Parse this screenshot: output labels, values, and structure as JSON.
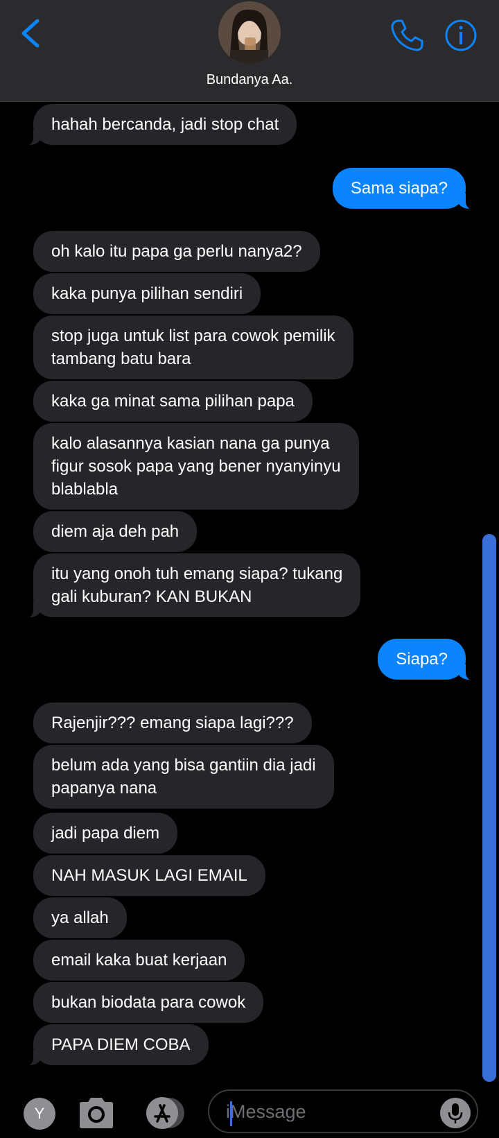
{
  "header": {
    "contact_name": "Bundanya Aa."
  },
  "messages": [
    {
      "dir": "in",
      "text": "hahah bercanda, jadi stop chat",
      "tail": true
    },
    {
      "dir": "out",
      "text": "Sama siapa?",
      "tail": true
    },
    {
      "dir": "in",
      "text": "oh kalo itu papa ga perlu nanya2?",
      "tail": false
    },
    {
      "dir": "in",
      "text": "kaka punya pilihan sendiri",
      "tail": false
    },
    {
      "dir": "in",
      "text": "stop juga untuk list para cowok pemilik\ntambang batu bara",
      "tail": false
    },
    {
      "dir": "in",
      "text": "kaka ga minat sama pilihan papa",
      "tail": false
    },
    {
      "dir": "in",
      "text": "kalo alasannya kasian nana ga punya\nfigur sosok papa yang bener nyanyinyu\nblablabla",
      "tail": false
    },
    {
      "dir": "in",
      "text": "diem aja deh pah",
      "tail": false
    },
    {
      "dir": "in",
      "text": "itu yang onoh tuh emang siapa? tukang\ngali kuburan? KAN BUKAN",
      "tail": true
    },
    {
      "dir": "out",
      "text": "Siapa?",
      "tail": true
    },
    {
      "dir": "in",
      "text": "Rajenjir??? emang siapa lagi???",
      "tail": false
    },
    {
      "dir": "in",
      "text": "belum ada yang bisa gantiin dia jadi\npapanya nana",
      "tail": false
    },
    {
      "dir": "in",
      "text": "jadi papa diem",
      "tail": false
    },
    {
      "dir": "in",
      "text": "NAH MASUK LAGI EMAIL",
      "tail": false
    },
    {
      "dir": "in",
      "text": "ya allah",
      "tail": false
    },
    {
      "dir": "in",
      "text": "email kaka buat kerjaan",
      "tail": false
    },
    {
      "dir": "in",
      "text": "bukan biodata para cowok",
      "tail": false
    },
    {
      "dir": "in",
      "text": "PAPA DIEM COBA",
      "tail": true
    }
  ],
  "composer": {
    "avatar_initial": "Y",
    "placeholder": "iMessage"
  },
  "icons": {
    "back": "chevron-left-icon",
    "call": "phone-icon",
    "info": "info-icon",
    "camera": "camera-icon",
    "apps": "app-store-icon",
    "mic": "microphone-icon"
  },
  "colors": {
    "accent": "#0b84fe",
    "incoming_bubble": "#26252a",
    "header_bg": "#2b2b2d",
    "scrollbar": "#3a6fd9"
  }
}
